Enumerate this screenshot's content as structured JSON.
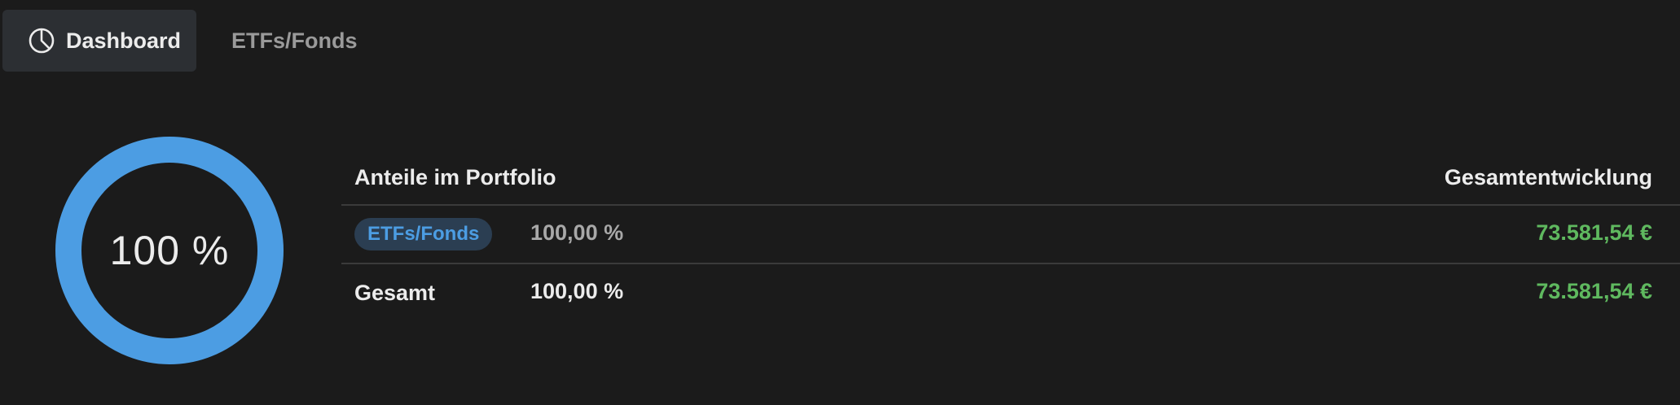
{
  "tabs": [
    {
      "label": "Dashboard",
      "icon": "pie-chart-icon",
      "active": true
    },
    {
      "label": "ETFs/Fonds",
      "active": false
    }
  ],
  "donut": {
    "value_percent": 100,
    "label": "100 %",
    "color": "#4c9de3"
  },
  "table": {
    "headers": {
      "left": "Anteile im Portfolio",
      "right": "Gesamtentwicklung"
    },
    "rows": [
      {
        "category": "ETFs/Fonds",
        "share": "100,00 %",
        "development": "73.581,54 €"
      }
    ],
    "total": {
      "label": "Gesamt",
      "share": "100,00 %",
      "development": "73.581,54 €"
    }
  },
  "colors": {
    "background": "#1b1b1b",
    "accent": "#4c9de3",
    "positive": "#5fb95f"
  }
}
